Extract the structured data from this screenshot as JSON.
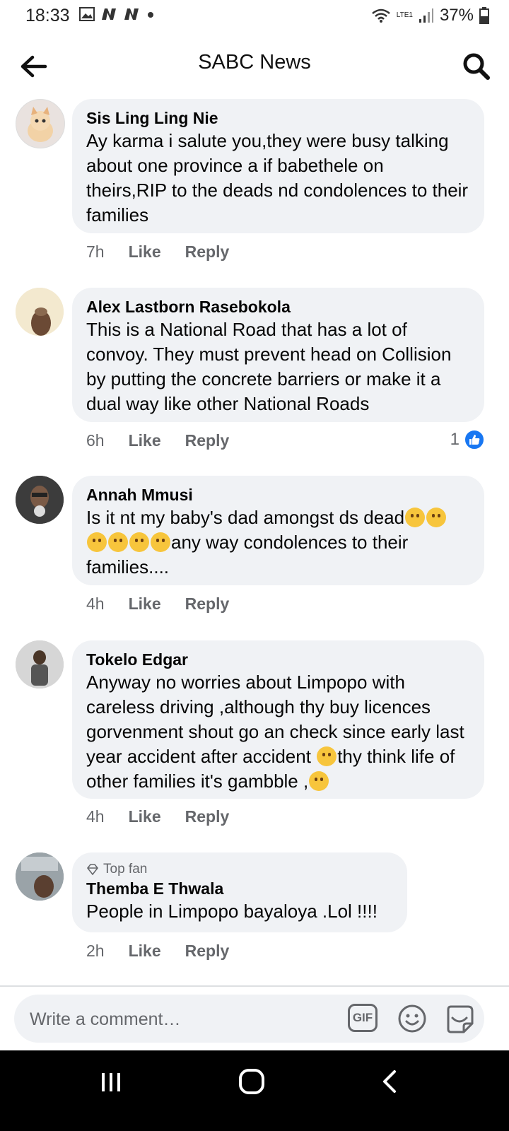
{
  "status_bar": {
    "time": "18:33",
    "battery": "37%",
    "network": "LTE1"
  },
  "app_bar": {
    "title": "SABC News"
  },
  "comments": [
    {
      "author": "Sis Ling Ling Nie",
      "text": "Ay karma i salute you,they were busy talking about one province a if babethele on theirs,RIP to the deads nd condolences to their families",
      "time": "7h",
      "like": "Like",
      "reply": "Reply"
    },
    {
      "author": "Alex Lastborn Rasebokola",
      "text": "This is a National Road that has a lot of convoy. They must prevent head on Collision by putting the concrete barriers or make it a dual way like other National Roads",
      "time": "6h",
      "like": "Like",
      "reply": "Reply",
      "reaction_count": "1"
    },
    {
      "author": "Annah Mmusi",
      "text_a": "Is it nt my baby's dad amongst ds dead",
      "text_b": "any way condolences to their families....",
      "time": "4h",
      "like": "Like",
      "reply": "Reply"
    },
    {
      "author": "Tokelo Edgar",
      "text_a": "Anyway no worries about Limpopo with careless driving ,although thy buy licences gorvenment shout go an check since early last year accident after accident ",
      "text_b": "thy think life of other families it's gambble ,",
      "time": "4h",
      "like": "Like",
      "reply": "Reply"
    },
    {
      "badge": "Top fan",
      "author": "Themba E Thwala",
      "text": "People in Limpopo bayaloya .Lol !!!!",
      "time": "2h",
      "like": "Like",
      "reply": "Reply"
    }
  ],
  "composer": {
    "placeholder": "Write a comment…",
    "gif_label": "GIF"
  },
  "colors": {
    "bubble": "#f0f2f5",
    "meta": "#65676b",
    "like_blue": "#1877f2"
  },
  "icons": [
    "back-arrow-icon",
    "search-icon",
    "like-reaction-icon",
    "gif-icon",
    "emoji-icon",
    "sticker-icon"
  ]
}
